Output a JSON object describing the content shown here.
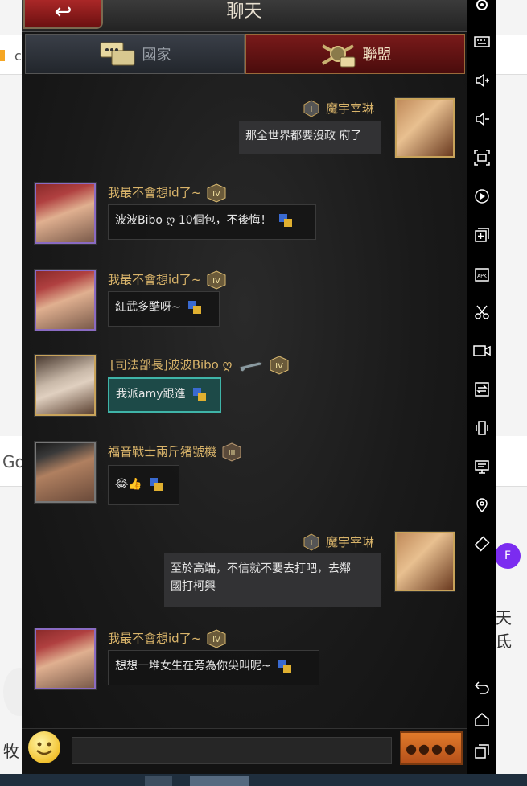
{
  "window": {
    "title": "聊天",
    "back_label": "↩"
  },
  "tabs": [
    {
      "label": "國家",
      "active": false
    },
    {
      "label": "聯盟",
      "active": true
    }
  ],
  "messages": [
    {
      "side": "right",
      "name": "魔宇宰琳",
      "text": "那全世界都要沒政 府了"
    },
    {
      "side": "left",
      "name": "我最不會想id了~",
      "text": "波波Bibo ღ 10個包，不後悔！"
    },
    {
      "side": "left",
      "name": "我最不會想id了~",
      "text": "紅武多酷呀~"
    },
    {
      "side": "left",
      "name": "[司法部長]波波Bibo ღ",
      "text": "我派amy跟進"
    },
    {
      "side": "left",
      "name": "福音戰士兩斤猪號機",
      "text": "😂👍"
    },
    {
      "side": "right",
      "name": "魔宇宰琳",
      "text_line1": "至於高端，不信就不要去打吧，去鄰",
      "text_line2": "國打柯興"
    },
    {
      "side": "left",
      "name": "我最不會想id了~",
      "text": "想想一堆女生在旁為你尖叫呢~"
    }
  ],
  "input": {
    "value": "",
    "send_label": "●●●●"
  },
  "background_page": {
    "left_char_1": "c",
    "left_char_2": "Go",
    "left_char_3": "牧",
    "right_text": "天氐",
    "avatar_letter": "F"
  },
  "icons": [
    "settings-icon",
    "keyboard-icon",
    "volume-up-icon",
    "volume-down-icon",
    "screenshot-icon",
    "play-icon",
    "add-window-icon",
    "apk-icon",
    "cut-icon",
    "record-icon",
    "swap-icon",
    "shake-icon",
    "display-icon",
    "location-icon",
    "rotate-icon",
    "back-icon",
    "home-icon",
    "recents-icon"
  ],
  "colors": {
    "name_gold": "#d9b46a",
    "tab_active": "#7a1a1a",
    "teal_border": "#3fb4a8"
  }
}
